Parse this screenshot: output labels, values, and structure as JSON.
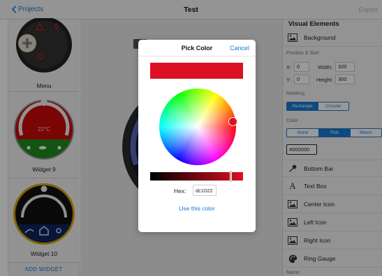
{
  "topbar": {
    "back_label": "Projects",
    "title": "Test",
    "export_label": "Export"
  },
  "sidebar": {
    "widgets": [
      {
        "label": "Menu"
      },
      {
        "label": "Widget 9",
        "value": "22°C"
      },
      {
        "label": "Widget 10"
      }
    ],
    "add_widget_label": "ADD WIDGET"
  },
  "right_panel": {
    "heading": "Visual Elements",
    "background_label": "Background",
    "position_size": {
      "section": "Position & Size",
      "x_label": "X:",
      "x_value": "0",
      "width_label": "Width:",
      "width_value": "320",
      "y_label": "Y:",
      "y_value": "0",
      "height_label": "Height:",
      "height_value": "300"
    },
    "masking": {
      "section": "Masking",
      "options": [
        "Rectangle",
        "Circular"
      ],
      "selected": "Rectangle"
    },
    "color": {
      "section": "Color",
      "options": [
        "None",
        "Pick",
        "Match"
      ],
      "selected": "Pick",
      "hex_value": "#000000"
    },
    "elements": [
      {
        "label": "Bottom Bar",
        "icon": "eyedropper-icon"
      },
      {
        "label": "Text Box",
        "icon": "text-icon"
      },
      {
        "label": "Center Icon",
        "icon": "image-icon"
      },
      {
        "label": "Left Icon",
        "icon": "image-icon"
      },
      {
        "label": "Right Icon",
        "icon": "image-icon"
      },
      {
        "label": "Ring Gauge",
        "icon": "palette-icon"
      }
    ],
    "name_section": "Name"
  },
  "modal": {
    "title": "Pick Color",
    "cancel_label": "Cancel",
    "hex_label": "Hex:",
    "hex_value": "dc1022",
    "use_color_label": "Use this color",
    "selected_color": "#dc1022"
  },
  "colors": {
    "accent": "#1a7ad0",
    "widget9_red": "#cc0a0a",
    "widget9_green": "#1e8c1e",
    "widget10_navy": "#0d2560",
    "widget10_gold": "#d9a400"
  }
}
